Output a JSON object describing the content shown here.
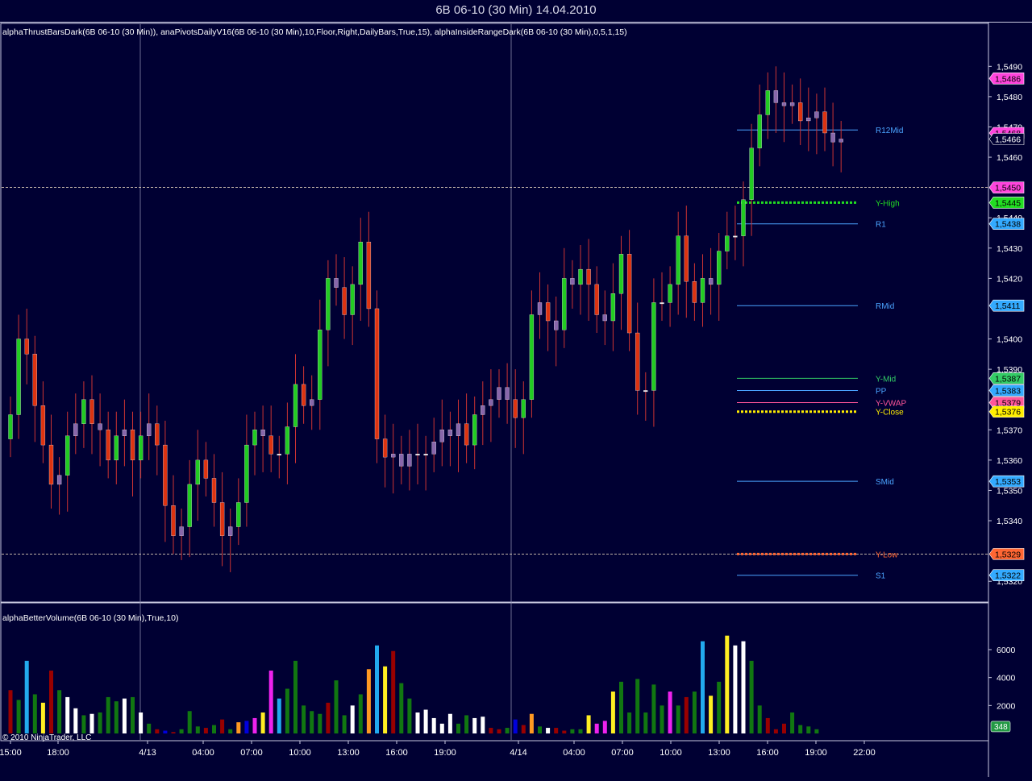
{
  "window": {
    "title": "6B 06-10 (30 Min)  14.04.2010"
  },
  "price_panel": {
    "indicator_caption": "alphaThrustBarsDark(6B 06-10 (30 Min)), anaPivotsDailyV16(6B 06-10 (30 Min),10,Floor,Right,DailyBars,True,15), alphaInsideRangeDark(6B 06-10 (30 Min),0,5,1,15)"
  },
  "volume_panel": {
    "indicator_caption": "alphaBetterVolume(6B 06-10 (30 Min),True,10)",
    "last_volume_badge": "348"
  },
  "copyright": "© 2010 NinjaTrader, LLC",
  "colors": {
    "background": "#000033",
    "grid": "#5a5a7a",
    "up_candle": "#22cc22",
    "down_candle": "#dd3311",
    "neutral_candle": "#8866aa",
    "wick": "#cc3333",
    "pivot_line": "#4aa3ff",
    "magenta_line": "#cc33cc"
  },
  "chart_data": [
    {
      "type": "candlestick",
      "instrument": "6B 06-10",
      "interval": "30 Min",
      "ylim": [
        1.5315,
        1.5497
      ],
      "y_ticks": [
        "1,5490",
        "1,5480",
        "1,5470",
        "1,5460",
        "1,5440",
        "1,5430",
        "1,5420",
        "1,5400",
        "1,5390",
        "1,5370",
        "1,5360",
        "1,5350",
        "1,5340",
        "1,5320"
      ],
      "x_tick_labels": [
        "15:00",
        "18:00",
        "4/13",
        "04:00",
        "07:00",
        "10:00",
        "13:00",
        "16:00",
        "19:00",
        "4/14",
        "04:00",
        "07:00",
        "10:00",
        "13:00",
        "16:00",
        "19:00",
        "22:00"
      ],
      "price_badges": [
        {
          "label": "1,5486",
          "price": 1.5486,
          "color": "#ff44dd"
        },
        {
          "label": "1,5468",
          "price": 1.5468,
          "color": "#ff44dd"
        },
        {
          "label": "1,5466",
          "price": 1.5466,
          "color": "#ffffff"
        },
        {
          "label": "1,5450",
          "price": 1.545,
          "color": "#ff44dd"
        },
        {
          "label": "1,5445",
          "price": 1.5445,
          "color": "#22dd22"
        },
        {
          "label": "1,5438",
          "price": 1.5438,
          "color": "#33aaff"
        },
        {
          "label": "1,5411",
          "price": 1.5411,
          "color": "#33aaff"
        },
        {
          "label": "1,5387",
          "price": 1.5387,
          "color": "#33cc66"
        },
        {
          "label": "1,5383",
          "price": 1.5383,
          "color": "#33aaff"
        },
        {
          "label": "1,5379",
          "price": 1.5379,
          "color": "#ff5599"
        },
        {
          "label": "1,5376",
          "price": 1.5376,
          "color": "#ffee00"
        },
        {
          "label": "1,5353",
          "price": 1.5353,
          "color": "#33aaff"
        },
        {
          "label": "1,5329",
          "price": 1.5329,
          "color": "#ff6633"
        },
        {
          "label": "1,5322",
          "price": 1.5322,
          "color": "#33aaff"
        }
      ],
      "pivot_levels": [
        {
          "name": "R12Mid",
          "price": 1.5469,
          "color": "#4aa3ff",
          "style": "solid"
        },
        {
          "name": "Y-High",
          "price": 1.5445,
          "color": "#22dd22",
          "style": "dotted"
        },
        {
          "name": "R1",
          "price": 1.5438,
          "color": "#4aa3ff",
          "style": "solid"
        },
        {
          "name": "RMid",
          "price": 1.5411,
          "color": "#4aa3ff",
          "style": "solid"
        },
        {
          "name": "Y-Mid",
          "price": 1.5387,
          "color": "#33cc66",
          "style": "solid"
        },
        {
          "name": "PP",
          "price": 1.5383,
          "color": "#4aa3ff",
          "style": "solid"
        },
        {
          "name": "Y-VWAP",
          "price": 1.5379,
          "color": "#ff5599",
          "style": "solid"
        },
        {
          "name": "Y-Close",
          "price": 1.5376,
          "color": "#ffee00",
          "style": "dotted"
        },
        {
          "name": "SMid",
          "price": 1.5353,
          "color": "#4aa3ff",
          "style": "solid"
        },
        {
          "name": "Y-Low",
          "price": 1.5329,
          "color": "#ff6633",
          "style": "dotted"
        },
        {
          "name": "S1",
          "price": 1.5322,
          "color": "#4aa3ff",
          "style": "solid"
        }
      ],
      "horizontal_lines": [
        {
          "price": 1.545,
          "color": "#ffeecc"
        },
        {
          "price": 1.5329,
          "color": "#ffeecc"
        }
      ],
      "series": [
        {
          "name": "close",
          "values": [
            1.5375,
            1.54,
            1.5395,
            1.5378,
            1.5365,
            1.5352,
            1.5355,
            1.5368,
            1.5372,
            1.538,
            1.5372,
            1.537,
            1.536,
            1.5368,
            1.537,
            1.536,
            1.5368,
            1.5372,
            1.5365,
            1.5345,
            1.5335,
            1.5338,
            1.5352,
            1.536,
            1.5354,
            1.5346,
            1.5335,
            1.5338,
            1.5346,
            1.5365,
            1.537,
            1.5368,
            1.5362,
            1.5362,
            1.5371,
            1.5385,
            1.5378,
            1.538,
            1.5403,
            1.542,
            1.5417,
            1.5408,
            1.5418,
            1.5432,
            1.541,
            1.5367,
            1.5361,
            1.5362,
            1.5358,
            1.5362,
            1.5362,
            1.5362,
            1.5366,
            1.537,
            1.5368,
            1.5372,
            1.5365,
            1.5375,
            1.5378,
            1.538,
            1.5384,
            1.538,
            1.5374,
            1.538,
            1.5408,
            1.5412,
            1.5406,
            1.5403,
            1.542,
            1.5418,
            1.5423,
            1.5418,
            1.5408,
            1.5406,
            1.5415,
            1.5428,
            1.5402,
            1.5383,
            1.5383,
            1.5412,
            1.5412,
            1.5418,
            1.5434,
            1.5419,
            1.5412,
            1.542,
            1.5418,
            1.5429,
            1.5434,
            1.5434,
            1.5446,
            1.5463,
            1.5474,
            1.5482,
            1.5478,
            1.5477,
            1.5478,
            1.5472,
            1.5473,
            1.5475,
            1.5468,
            1.5465,
            1.5466
          ]
        },
        {
          "name": "volume",
          "values": [
            3100,
            2400,
            5200,
            2800,
            2200,
            4500,
            3100,
            2600,
            1800,
            1300,
            1400,
            1500,
            2600,
            2300,
            2500,
            2600,
            1500,
            700,
            300,
            200,
            100,
            300,
            1600,
            500,
            400,
            600,
            1000,
            300,
            800,
            900,
            1100,
            1500,
            4500,
            2500,
            3200,
            5200,
            2000,
            1600,
            1400,
            2200,
            3800,
            1300,
            2000,
            2800,
            4600,
            6300,
            4800,
            5900,
            3600,
            2500,
            1500,
            1700,
            1100,
            700,
            1400,
            700,
            1300,
            1100,
            1200,
            400,
            300,
            400,
            1000,
            600,
            1400,
            500,
            400,
            400,
            200,
            300,
            300,
            1300,
            700,
            900,
            3000,
            3700,
            1500,
            3900,
            1500,
            3500,
            2000,
            3000,
            2000,
            2600,
            3000,
            6600,
            2700,
            3700,
            7000,
            6300,
            6600,
            5200,
            2000,
            1100,
            300,
            700,
            1500,
            600,
            500,
            300
          ]
        },
        {
          "name": "volume_colors",
          "values": [
            "r",
            "g",
            "c",
            "g",
            "y",
            "r",
            "g",
            "w",
            "w",
            "g",
            "w",
            "g",
            "g",
            "g",
            "w",
            "g",
            "w",
            "g",
            "r",
            "b",
            "r",
            "g",
            "g",
            "g",
            "r",
            "g",
            "r",
            "g",
            "o",
            "b",
            "m",
            "y",
            "m",
            "c",
            "g",
            "g",
            "g",
            "g",
            "g",
            "r",
            "g",
            "g",
            "w",
            "g",
            "o",
            "c",
            "y",
            "r",
            "g",
            "g",
            "w",
            "w",
            "w",
            "w",
            "w",
            "g",
            "g",
            "w",
            "w",
            "r",
            "r",
            "g",
            "b",
            "r",
            "o",
            "g",
            "w",
            "r",
            "r",
            "g",
            "g",
            "y",
            "m",
            "m",
            "y",
            "g",
            "g",
            "g",
            "g",
            "g",
            "g",
            "m",
            "g",
            "r",
            "g",
            "c",
            "y",
            "g",
            "y",
            "w",
            "w",
            "g",
            "g",
            "r",
            "r",
            "r",
            "g"
          ]
        }
      ]
    },
    {
      "type": "bar",
      "title": "",
      "y_ticks": [
        "6000",
        "4000",
        "2000"
      ],
      "ylim": [
        0,
        7500
      ]
    }
  ]
}
